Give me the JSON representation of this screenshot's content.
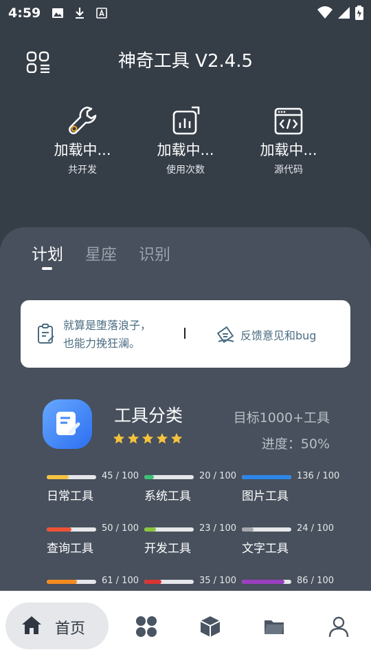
{
  "status_bar": {
    "time": "4:59"
  },
  "header": {
    "title": "神奇工具 V2.4.5"
  },
  "stats": [
    {
      "value": "加载中...",
      "label": "共开发",
      "icon": "wrench-icon"
    },
    {
      "value": "加载中...",
      "label": "使用次数",
      "icon": "chart-icon"
    },
    {
      "value": "加载中...",
      "label": "源代码",
      "icon": "code-icon"
    }
  ],
  "tabs": [
    {
      "label": "计划",
      "active": true
    },
    {
      "label": "星座",
      "active": false
    },
    {
      "label": "识别",
      "active": false
    }
  ],
  "quote": {
    "line1": "就算是堕落浪子，",
    "line2": "也能力挽狂澜。",
    "feedback": "反馈意见和bug"
  },
  "category": {
    "title": "工具分类",
    "stars": 5,
    "goal": "目标1000+工具",
    "progress_text": "进度：50%"
  },
  "tools": [
    {
      "name": "日常工具",
      "count": "45 / 100",
      "value": 45,
      "color": "#f5c342"
    },
    {
      "name": "系统工具",
      "count": "20 / 100",
      "value": 20,
      "color": "#3cc073"
    },
    {
      "name": "图片工具",
      "count": "136 / 100",
      "value": 136,
      "color": "#2d86e8"
    },
    {
      "name": "查询工具",
      "count": "50 / 100",
      "value": 50,
      "color": "#ee5235"
    },
    {
      "name": "开发工具",
      "count": "23 / 100",
      "value": 23,
      "color": "#8bc53f"
    },
    {
      "name": "文字工具",
      "count": "24 / 100",
      "value": 24,
      "color": "#a6a8ab"
    },
    {
      "name": "",
      "count": "61 / 100",
      "value": 61,
      "color": "#f58a1f"
    },
    {
      "name": "",
      "count": "35 / 100",
      "value": 35,
      "color": "#d93434"
    },
    {
      "name": "",
      "count": "86 / 100",
      "value": 86,
      "color": "#9b3fc1"
    }
  ],
  "bottom_nav": {
    "home_label": "首页",
    "items": [
      "home-icon",
      "apps-icon",
      "cube-icon",
      "folder-icon",
      "user-icon"
    ]
  }
}
